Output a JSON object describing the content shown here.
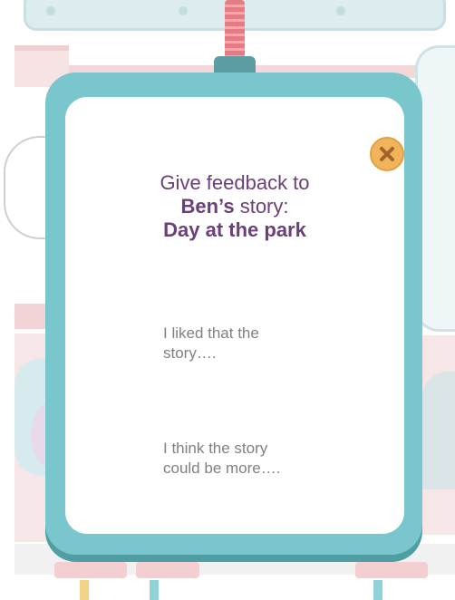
{
  "dialog": {
    "title_line1": "Give feedback to",
    "author_name": "Ben’s",
    "title_line2_suffix": " story:",
    "story_title": "Day at the park",
    "close_icon": "close-x-icon",
    "prompts": [
      "I liked that the\nstory….",
      "I think the story\ncould be more…."
    ]
  },
  "colors": {
    "frame": "#79c7cd",
    "frame_shadow": "#4f9ea4",
    "title_purple": "#6b3f78",
    "close_button": "#f0b45a",
    "close_x": "#a2632a"
  }
}
